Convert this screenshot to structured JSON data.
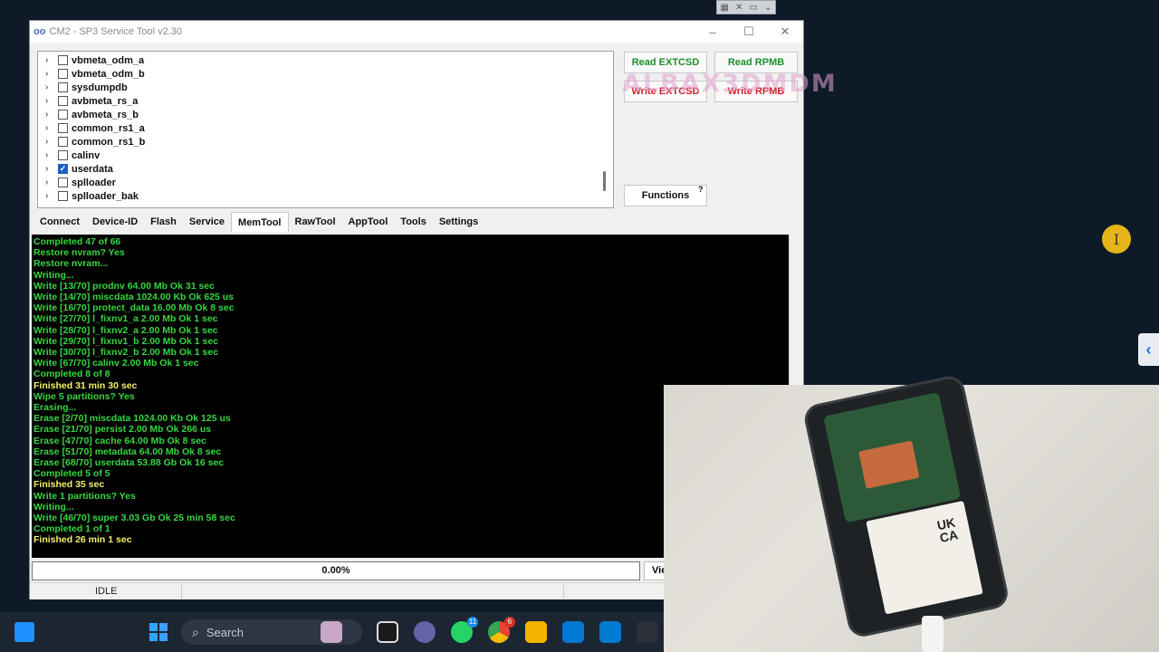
{
  "window": {
    "title": "CM2 - SP3 Service Tool v2.30",
    "logo": "CM2"
  },
  "partitions": [
    {
      "name": "vbmeta_odm_a",
      "checked": false
    },
    {
      "name": "vbmeta_odm_b",
      "checked": false
    },
    {
      "name": "sysdumpdb",
      "checked": false
    },
    {
      "name": "avbmeta_rs_a",
      "checked": false
    },
    {
      "name": "avbmeta_rs_b",
      "checked": false
    },
    {
      "name": "common_rs1_a",
      "checked": false
    },
    {
      "name": "common_rs1_b",
      "checked": false
    },
    {
      "name": "calinv",
      "checked": false
    },
    {
      "name": "userdata",
      "checked": true
    },
    {
      "name": "splloader",
      "checked": false
    },
    {
      "name": "splloader_bak",
      "checked": false
    }
  ],
  "buttons": {
    "read_extcsd": "Read EXTCSD",
    "read_rpmb": "Read RPMB",
    "write_extcsd": "Write EXTCSD",
    "write_rpmb": "Write RPMB",
    "functions": "Functions",
    "help": "?",
    "view": "Vie"
  },
  "watermark": "ALBAX3DMDM",
  "tabs": [
    {
      "label": "Connect",
      "active": false
    },
    {
      "label": "Device-ID",
      "active": false
    },
    {
      "label": "Flash",
      "active": false
    },
    {
      "label": "Service",
      "active": false
    },
    {
      "label": "MemTool",
      "active": true
    },
    {
      "label": "RawTool",
      "active": false
    },
    {
      "label": "AppTool",
      "active": false
    },
    {
      "label": "Tools",
      "active": false
    },
    {
      "label": "Settings",
      "active": false
    }
  ],
  "log": [
    {
      "text": "Completed 47 of 66",
      "color": "green"
    },
    {
      "text": "Restore nvram? Yes",
      "color": "green"
    },
    {
      "text": "Restore nvram...",
      "color": "green"
    },
    {
      "text": "Writing...",
      "color": "green"
    },
    {
      "text": "Write [13/70] prodnv 64.00 Mb Ok 31 sec",
      "color": "green"
    },
    {
      "text": "Write [14/70] miscdata 1024.00 Kb Ok 625 us",
      "color": "green"
    },
    {
      "text": "Write [16/70] protect_data 16.00 Mb Ok 8 sec",
      "color": "green"
    },
    {
      "text": "Write [27/70] l_fixnv1_a 2.00 Mb Ok 1 sec",
      "color": "green"
    },
    {
      "text": "Write [28/70] l_fixnv2_a 2.00 Mb Ok 1 sec",
      "color": "green"
    },
    {
      "text": "Write [29/70] l_fixnv1_b 2.00 Mb Ok 1 sec",
      "color": "green"
    },
    {
      "text": "Write [30/70] l_fixnv2_b 2.00 Mb Ok 1 sec",
      "color": "green"
    },
    {
      "text": "Write [67/70] calinv 2.00 Mb Ok 1 sec",
      "color": "green"
    },
    {
      "text": "Completed 8 of 8",
      "color": "green"
    },
    {
      "text": "Finished 31 min 30 sec",
      "color": "yellow"
    },
    {
      "text": "Wipe 5 partitions? Yes",
      "color": "green"
    },
    {
      "text": "Erasing...",
      "color": "green"
    },
    {
      "text": "Erase [2/70] miscdata 1024.00 Kb Ok 125 us",
      "color": "green"
    },
    {
      "text": "Erase [21/70] persist 2.00 Mb Ok 266 us",
      "color": "green"
    },
    {
      "text": "Erase [47/70] cache 64.00 Mb Ok 8 sec",
      "color": "green"
    },
    {
      "text": "Erase [51/70] metadata 64.00 Mb Ok 8 sec",
      "color": "green"
    },
    {
      "text": "Erase [68/70] userdata 53.88 Gb Ok 16 sec",
      "color": "green"
    },
    {
      "text": "Completed 5 of 5",
      "color": "green"
    },
    {
      "text": "Finished 35 sec",
      "color": "yellow"
    },
    {
      "text": "Write 1 partitions? Yes",
      "color": "green"
    },
    {
      "text": "Writing...",
      "color": "green"
    },
    {
      "text": "Write [46/70] super 3.03 Gb Ok 25 min 58 sec",
      "color": "green"
    },
    {
      "text": "Completed 1 of 1",
      "color": "green"
    },
    {
      "text": "Finished 26 min 1 sec",
      "color": "yellow"
    }
  ],
  "progress": {
    "text": "0.00%",
    "value": 0
  },
  "status": "IDLE",
  "phone_label": "UK\nCA",
  "taskbar": {
    "search_placeholder": "Search",
    "badges": {
      "whatsapp": "11",
      "chrome": "6"
    }
  },
  "colors": {
    "log_green": "#37d642",
    "log_yellow": "#f4f06a",
    "button_green": "#1f8f2b",
    "button_red": "#d0202b",
    "checkbox_blue": "#1d5fc8"
  }
}
